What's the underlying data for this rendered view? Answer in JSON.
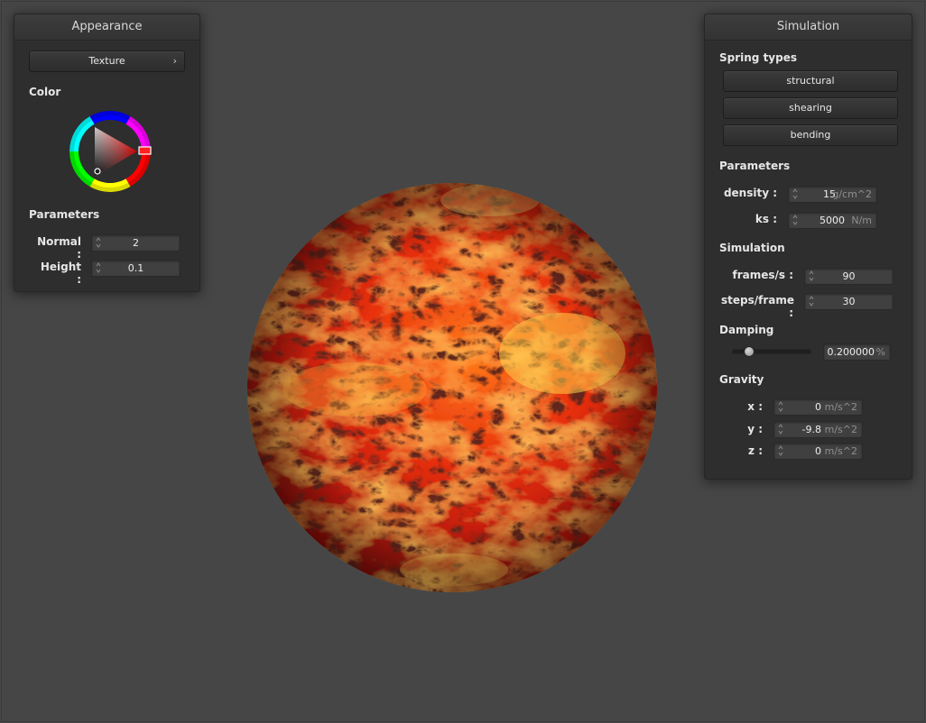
{
  "appearance": {
    "title": "Appearance",
    "texture_button": "Texture",
    "color_label": "Color",
    "parameters_label": "Parameters",
    "normal_label": "Normal :",
    "normal_value": "2",
    "height_label": "Height :",
    "height_value": "0.1"
  },
  "simulation": {
    "title": "Simulation",
    "spring_types_label": "Spring types",
    "spring_buttons": [
      "structural",
      "shearing",
      "bending"
    ],
    "parameters_label": "Parameters",
    "density_label": "density :",
    "density_value": "15",
    "density_unit": "g/cm^2",
    "ks_label": "ks :",
    "ks_value": "5000",
    "ks_unit": "N/m",
    "simulation_label": "Simulation",
    "fps_label": "frames/s :",
    "fps_value": "90",
    "steps_label": "steps/frame :",
    "steps_value": "30",
    "damping_label": "Damping",
    "damping_value": "0.200000",
    "damping_unit": "%",
    "damping_slider_fraction": 0.2,
    "gravity_label": "Gravity",
    "gx_label": "x :",
    "gx_value": "0",
    "gy_label": "y :",
    "gy_value": "-9.8",
    "gz_label": "z :",
    "gz_value": "0",
    "gravity_unit": "m/s^2"
  },
  "colors": {
    "background": "#464646",
    "panel": "#2e2e2e",
    "selected_color": "#ff0000"
  },
  "icons": {
    "texture_chevron": "chevron-right-icon",
    "spinner": "spinner-arrows-icon"
  }
}
